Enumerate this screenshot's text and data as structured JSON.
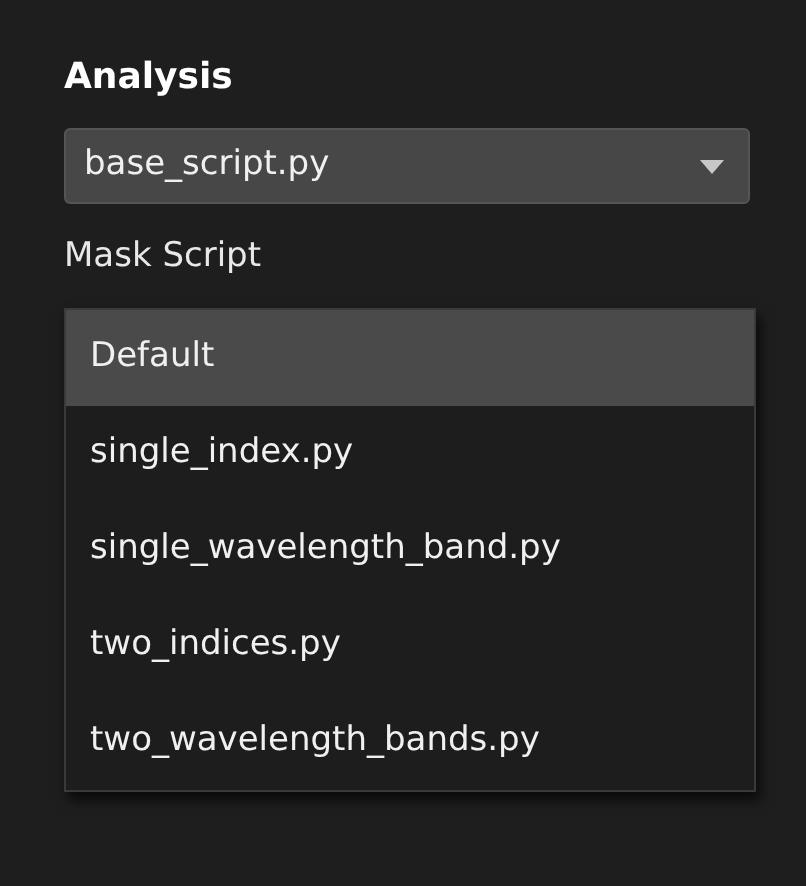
{
  "section_title": "Analysis",
  "analysis_dropdown": {
    "value": "base_script.py"
  },
  "mask_label": "Mask Script",
  "mask_options": [
    {
      "label": "Default",
      "selected": true
    },
    {
      "label": "single_index.py",
      "selected": false
    },
    {
      "label": "single_wavelength_band.py",
      "selected": false
    },
    {
      "label": "two_indices.py",
      "selected": false
    },
    {
      "label": "two_wavelength_bands.py",
      "selected": false
    }
  ]
}
